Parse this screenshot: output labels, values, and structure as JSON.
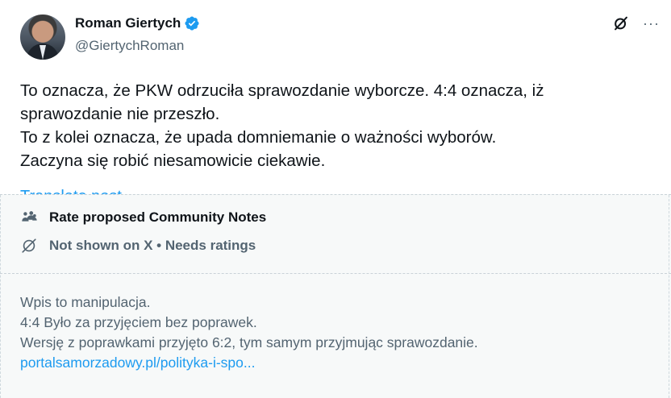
{
  "author": {
    "name": "Roman Giertych",
    "handle": "@GiertychRoman"
  },
  "icons": {
    "verified": "verified-badge-icon",
    "grok": "grok-slash-icon",
    "more": "more-options-icon",
    "people": "people-group-icon",
    "not_shown": "eye-off-slash-icon"
  },
  "colors": {
    "link": "#1d9bf0",
    "verified": "#1d9bf0",
    "secondary_text": "#536471"
  },
  "tweet": {
    "lines": [
      "To oznacza, że PKW odrzuciła sprawozdanie wyborcze. 4:4 oznacza, iż",
      "sprawozdanie nie przeszło.",
      "To z kolei oznacza, że upada domniemanie o ważności wyborów.",
      "Zaczyna się robić niesamowicie ciekawie."
    ],
    "truncated_link": "Translate post"
  },
  "community_notes": {
    "rate_label": "Rate proposed Community Notes",
    "status_label": "Not shown on X • Needs ratings",
    "note_lines": [
      "Wpis to manipulacja.",
      "4:4 Było za przyjęciem bez poprawek.",
      "Wersję z poprawkami przyjęto 6:2, tym samym przyjmując sprawozdanie."
    ],
    "note_link": "portalsamorzadowy.pl/polityka-i-spo..."
  },
  "more_label": "···"
}
